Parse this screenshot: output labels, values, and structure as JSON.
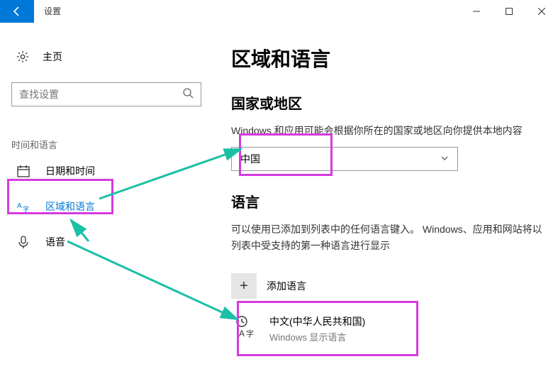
{
  "titlebar": {
    "title": "设置"
  },
  "sidebar": {
    "home_label": "主页",
    "search_placeholder": "查找设置",
    "group_label": "时间和语言",
    "items": [
      {
        "label": "日期和时间"
      },
      {
        "label": "区域和语言"
      },
      {
        "label": "语音"
      }
    ]
  },
  "main": {
    "page_title": "区域和语言",
    "country_section_title": "国家或地区",
    "country_helper": "Windows 和应用可能会根据你所在的国家或地区向你提供本地内容",
    "country_selected": "中国",
    "language_section_title": "语言",
    "language_helper": "可以使用已添加到列表中的任何语言键入。 Windows、应用和网站将以列表中受支持的第一种语言进行显示",
    "add_language_label": "添加语言",
    "languages": [
      {
        "name": "中文(中华人民共和国)",
        "subtitle": "Windows 显示语言"
      }
    ]
  }
}
